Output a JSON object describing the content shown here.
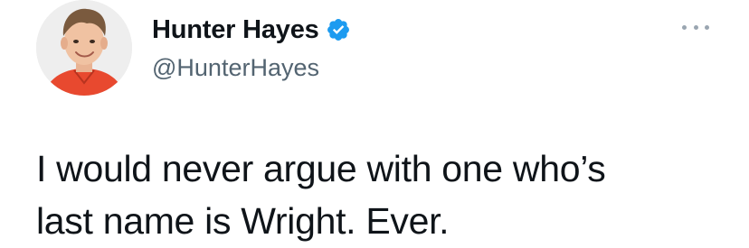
{
  "author": {
    "display_name": "Hunter Hayes",
    "handle": "@HunterHayes",
    "verified": true,
    "verified_icon": "verified-badge-icon",
    "avatar_icon": "profile-photo"
  },
  "tweet": {
    "text": "I would never argue with one who’s\nlast name is Wright. Ever."
  },
  "menu": {
    "icon": "more-options-icon"
  },
  "colors": {
    "verified_blue": "#1d9bf0",
    "handle_gray": "#536471",
    "text": "#0f1419"
  }
}
